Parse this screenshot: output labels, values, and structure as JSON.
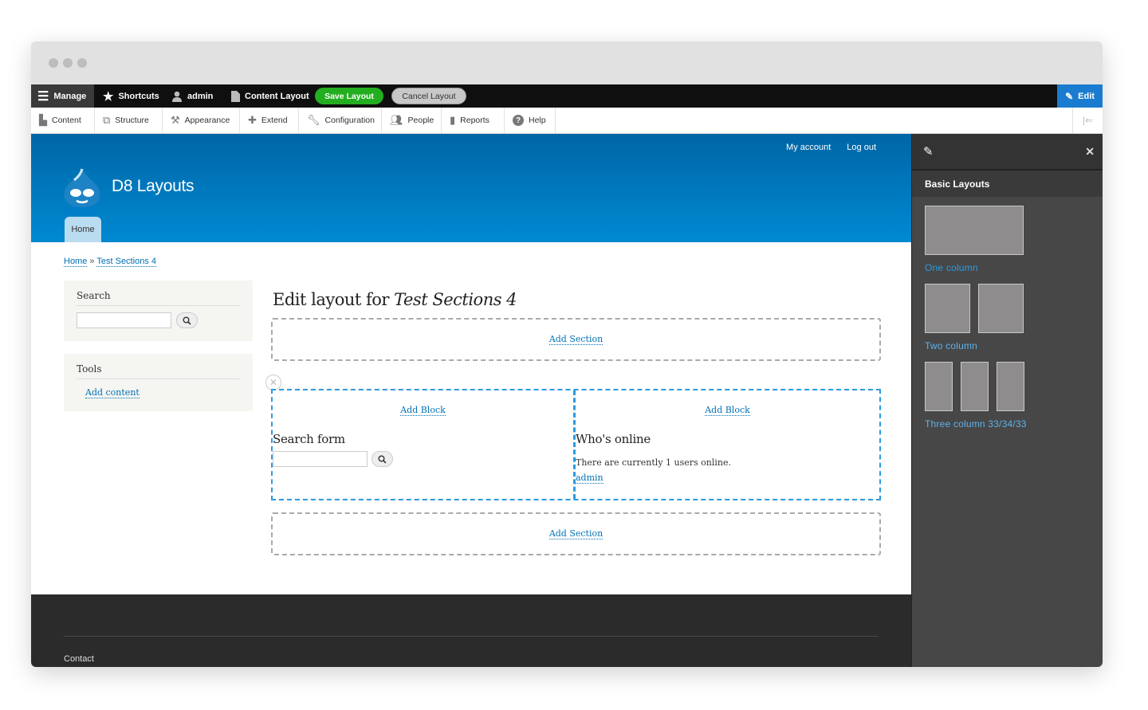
{
  "toolbar": {
    "manage": "Manage",
    "shortcuts": "Shortcuts",
    "user": "admin",
    "content_layout": "Content Layout",
    "save_layout": "Save Layout",
    "cancel_layout": "Cancel Layout",
    "edit": "Edit",
    "accent_color": "#1a7cd0",
    "save_color": "#23ae20"
  },
  "admin_menu": {
    "items": [
      {
        "label": "Content",
        "icon": "file-icon"
      },
      {
        "label": "Structure",
        "icon": "sitemap-icon"
      },
      {
        "label": "Appearance",
        "icon": "paintbrush-icon"
      },
      {
        "label": "Extend",
        "icon": "puzzle-icon"
      },
      {
        "label": "Configuration",
        "icon": "wrench-icon"
      },
      {
        "label": "People",
        "icon": "people-icon"
      },
      {
        "label": "Reports",
        "icon": "bar-chart-icon"
      },
      {
        "label": "Help",
        "icon": "help-icon"
      }
    ]
  },
  "header": {
    "site_name": "D8 Layouts",
    "secondary_menu": [
      "My account",
      "Log out"
    ],
    "primary_tab": "Home"
  },
  "breadcrumb": {
    "home": "Home",
    "separator": "»",
    "current": "Test Sections 4"
  },
  "sidebar": {
    "search_title": "Search",
    "search_value": "",
    "tools_title": "Tools",
    "tools_link": "Add content"
  },
  "main": {
    "title_prefix": "Edit layout for ",
    "title_node": "Test Sections 4",
    "add_section": "Add Section",
    "add_block": "Add Block",
    "region1": {
      "block_title": "Search form",
      "search_value": ""
    },
    "region2": {
      "block_title": "Who's online",
      "text": "There are currently 1 users online.",
      "user_link": "admin"
    }
  },
  "footer": {
    "link": "Contact"
  },
  "offcanvas": {
    "section_title": "Basic Layouts",
    "options": [
      {
        "label": "One column",
        "columns": 1
      },
      {
        "label": "Two column",
        "columns": 2
      },
      {
        "label": "Three column 33/34/33",
        "columns": 3
      }
    ]
  }
}
